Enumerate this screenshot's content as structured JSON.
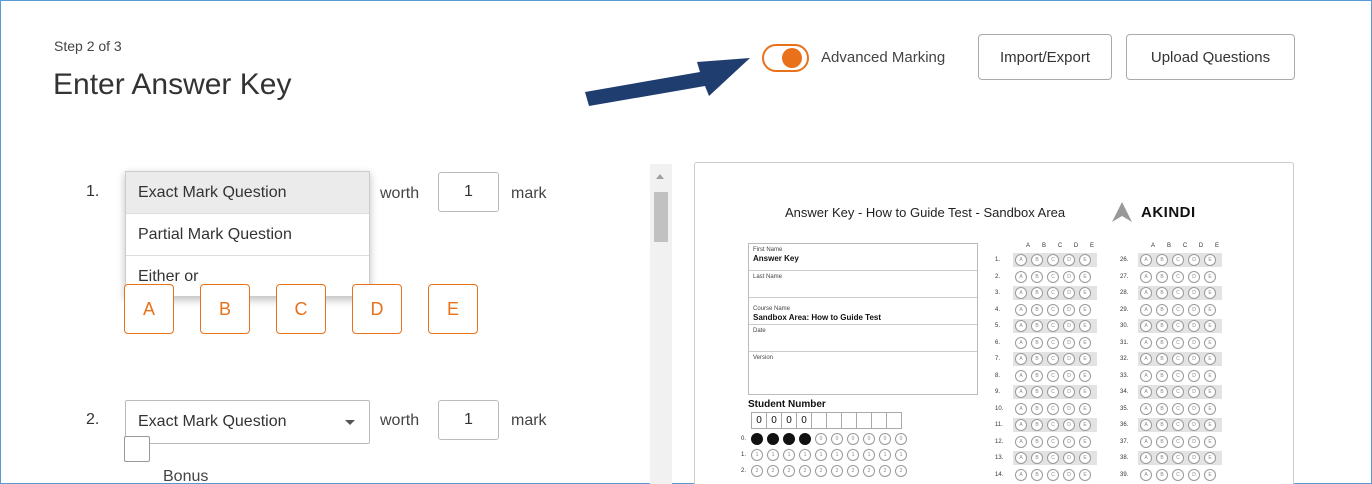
{
  "header": {
    "step": "Step 2 of 3",
    "title": "Enter Answer Key",
    "advanced_marking_label": "Advanced Marking",
    "advanced_marking_on": true,
    "import_export_label": "Import/Export",
    "upload_questions_label": "Upload Questions"
  },
  "colors": {
    "accent": "#e8711a",
    "arrow": "#1f3d6e",
    "frame": "#5b9bd5"
  },
  "questions": [
    {
      "number": "1.",
      "type": "Exact Mark Question",
      "worth_label": "worth",
      "marks": "1",
      "mark_word": "mark",
      "choices": [
        "A",
        "B",
        "C",
        "D",
        "E"
      ],
      "dropdown_open": true,
      "dropdown_options": [
        "Exact Mark Question",
        "Partial Mark Question",
        "Either or"
      ]
    },
    {
      "number": "2.",
      "type": "Exact Mark Question",
      "worth_label": "worth",
      "marks": "1",
      "mark_word": "mark",
      "bonus_label": "Bonus"
    }
  ],
  "preview": {
    "title": "Answer Key - How to Guide Test - Sandbox Area",
    "logo_text": "AKINDI",
    "fields": [
      {
        "label": "First Name",
        "value": "Answer Key"
      },
      {
        "label": "Last Name",
        "value": ""
      },
      {
        "label": "Course Name",
        "value": "Sandbox Area: How to Guide Test"
      },
      {
        "label": "Date",
        "value": ""
      },
      {
        "label": "Version",
        "value": ""
      }
    ],
    "student_number_label": "Student Number",
    "student_number_digits": [
      "0",
      "0",
      "0",
      "0",
      "",
      "",
      "",
      "",
      "",
      ""
    ],
    "choice_headers": [
      "A",
      "B",
      "C",
      "D",
      "E"
    ],
    "left_column_start": 1,
    "right_column_start": 26
  }
}
